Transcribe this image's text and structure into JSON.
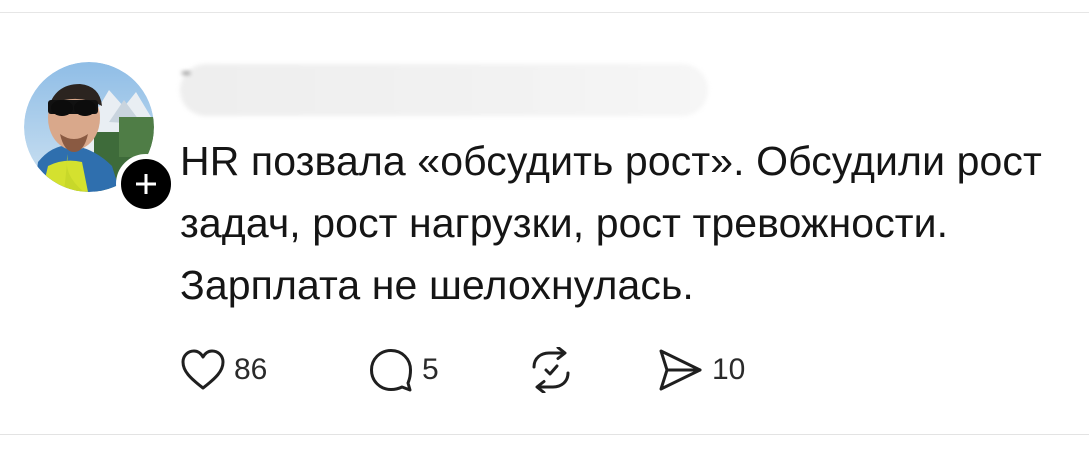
{
  "post": {
    "text": "HR позвала «обсудить рост». Обсудили рост задач, рост нагрузки, рост тревожности. Зарплата не шелохнулась.",
    "follow_symbol": "+"
  },
  "actions": {
    "like": {
      "icon": "heart-icon",
      "count": "86"
    },
    "reply": {
      "icon": "comment-icon",
      "count": "5"
    },
    "repost": {
      "icon": "repost-icon",
      "count": ""
    },
    "share": {
      "icon": "send-icon",
      "count": "10"
    }
  },
  "colors": {
    "text": "#151515",
    "icon": "#1f1f1f",
    "badge": "#000000",
    "background": "#ffffff"
  }
}
